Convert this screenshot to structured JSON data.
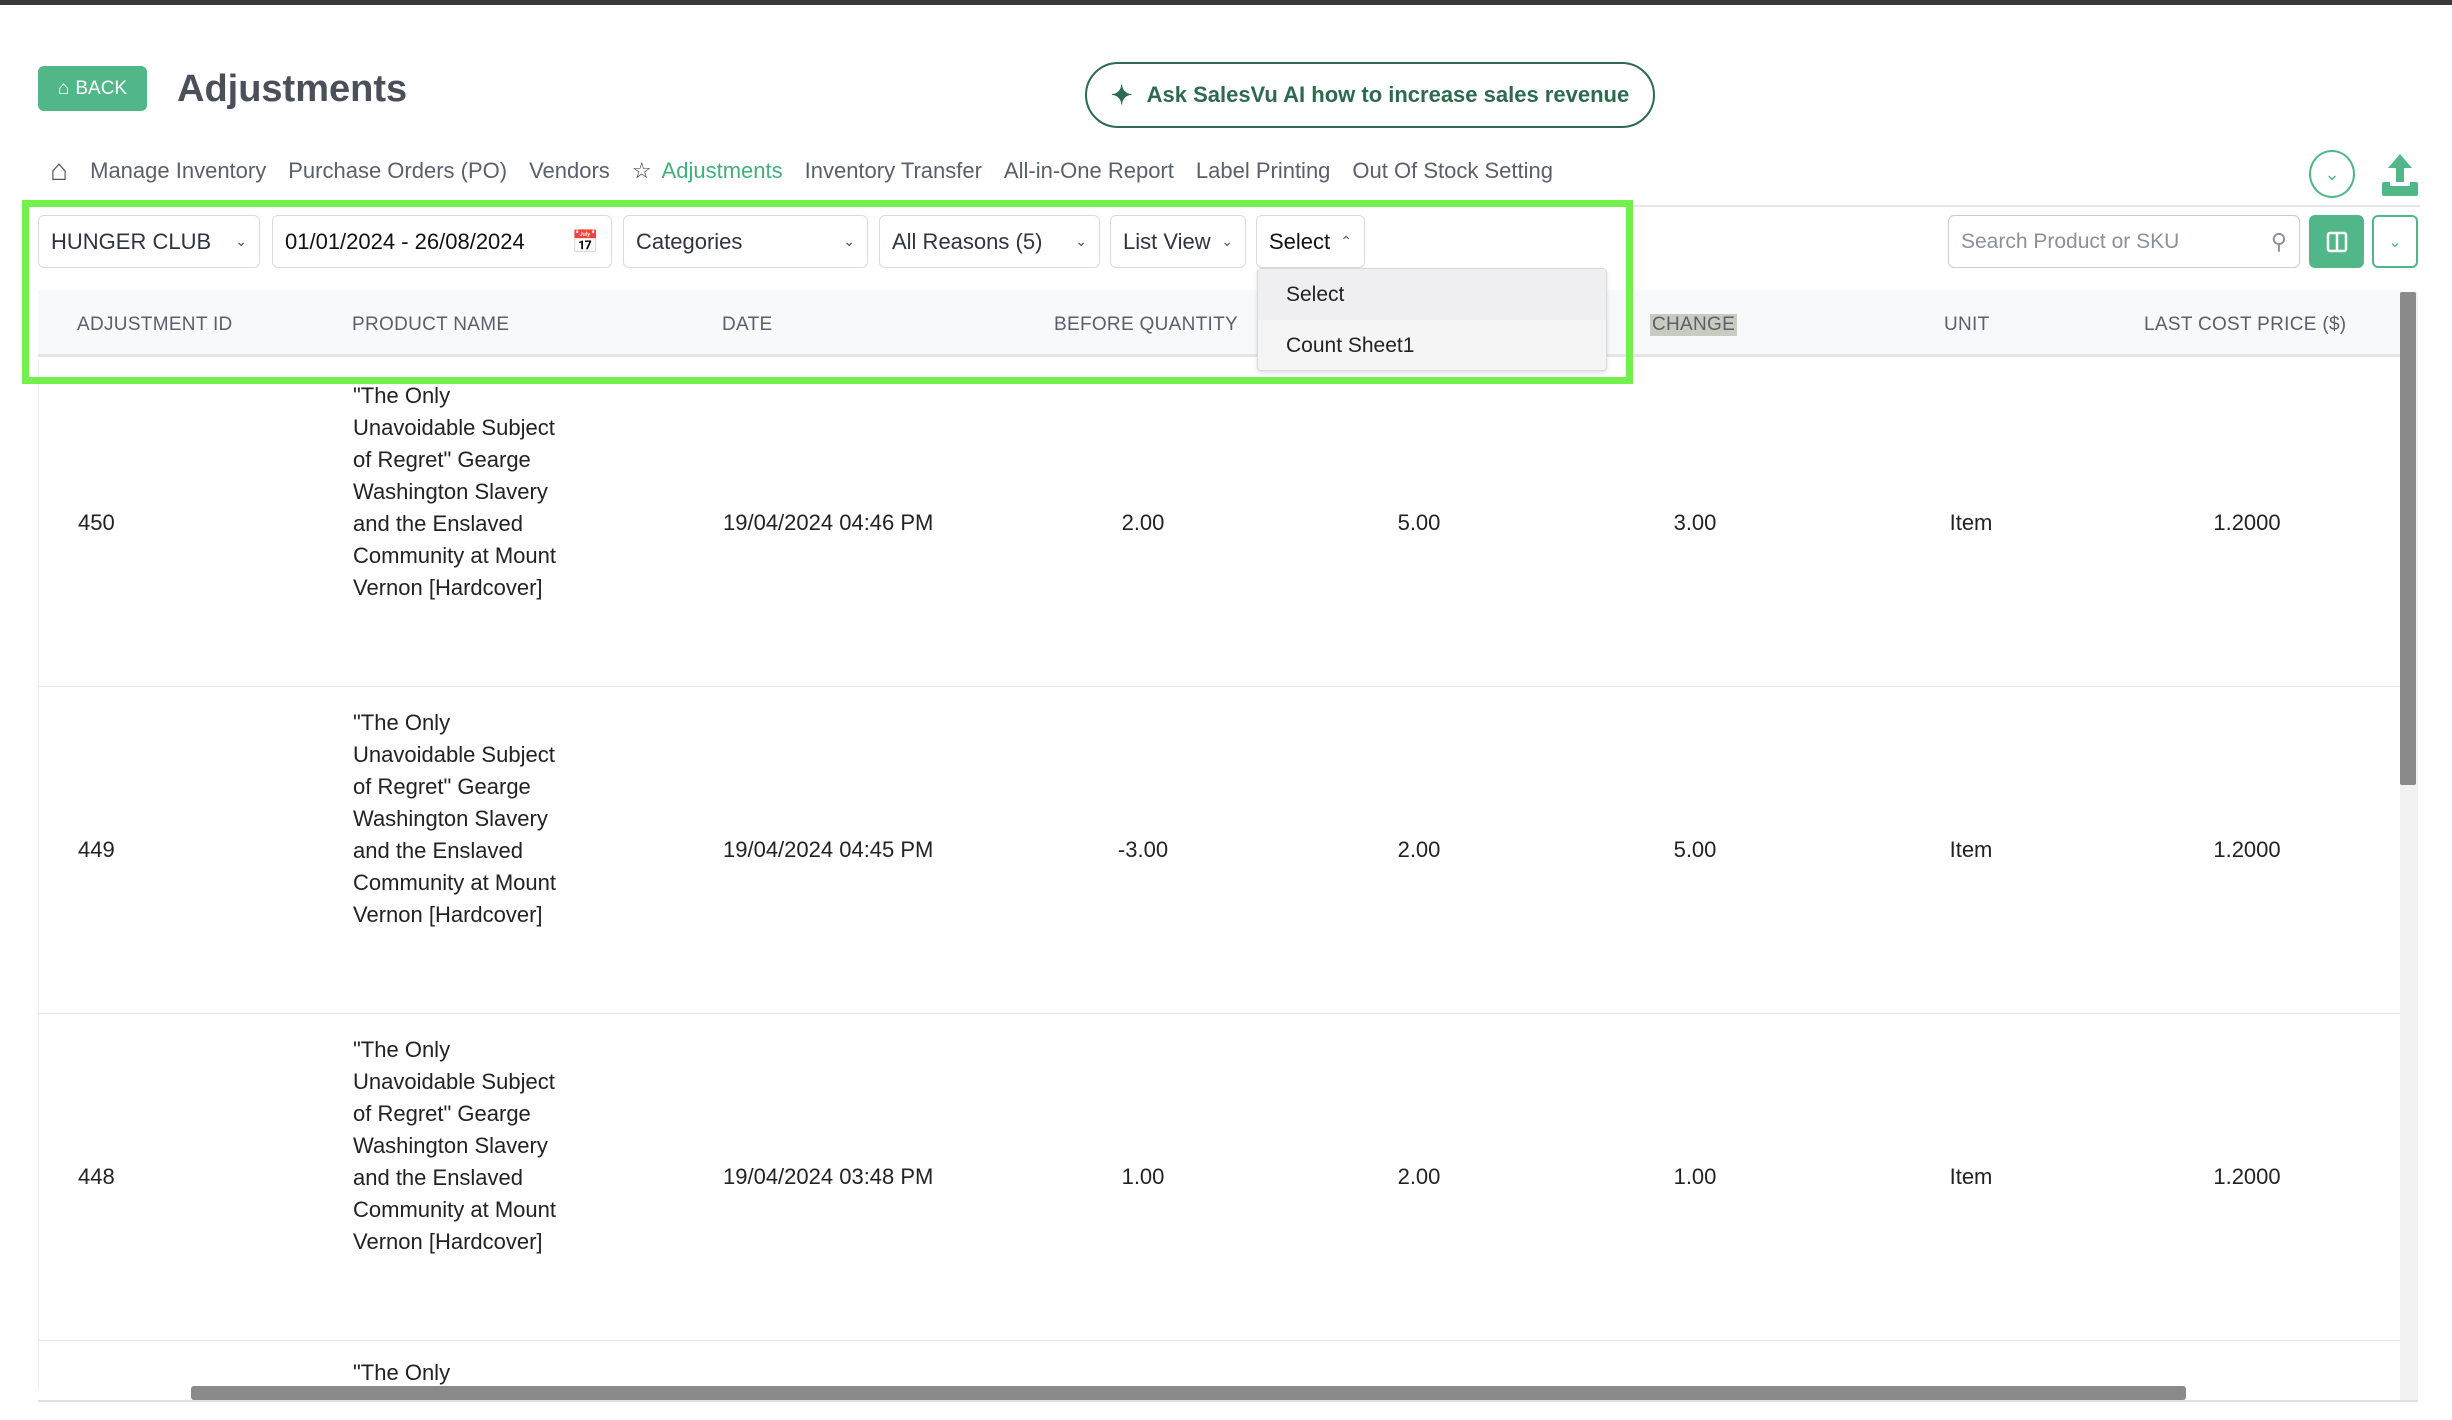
{
  "header": {
    "back_label": "BACK",
    "title": "Adjustments",
    "ai_button": "Ask SalesVu AI how to increase sales revenue"
  },
  "nav": {
    "items": [
      "Manage Inventory",
      "Purchase Orders (PO)",
      "Vendors",
      "Adjustments",
      "Inventory Transfer",
      "All-in-One Report",
      "Label Printing",
      "Out Of Stock Setting"
    ],
    "active": "Adjustments"
  },
  "filters": {
    "location": "HUNGER CLUB",
    "date_range": "01/01/2024 - 26/08/2024",
    "categories": "Categories",
    "reasons": "All Reasons (5)",
    "view": "List View",
    "select": "Select"
  },
  "dropdown": {
    "options": [
      "Select",
      "Count Sheet1"
    ]
  },
  "search": {
    "placeholder": "Search Product or SKU"
  },
  "table": {
    "headers": [
      "ADJUSTMENT ID",
      "PRODUCT NAME",
      "DATE",
      "BEFORE QUANTITY",
      "",
      "CHANGE",
      "UNIT",
      "LAST COST PRICE ($)"
    ],
    "rows": [
      {
        "id": "450",
        "product": "\"The Only Unavoidable Subject of Regret\" Gearge Washington Slavery and the Enslaved Community at Mount Vernon [Hardcover]",
        "date": "19/04/2024 04:46 PM",
        "before": "2.00",
        "after": "5.00",
        "change": "3.00",
        "unit": "Item",
        "cost": "1.2000"
      },
      {
        "id": "449",
        "product": "\"The Only Unavoidable Subject of Regret\" Gearge Washington Slavery and the Enslaved Community at Mount Vernon [Hardcover]",
        "date": "19/04/2024 04:45 PM",
        "before": "-3.00",
        "after": "2.00",
        "change": "5.00",
        "unit": "Item",
        "cost": "1.2000"
      },
      {
        "id": "448",
        "product": "\"The Only Unavoidable Subject of Regret\" Gearge Washington Slavery and the Enslaved Community at Mount Vernon [Hardcover]",
        "date": "19/04/2024 03:48 PM",
        "before": "1.00",
        "after": "2.00",
        "change": "1.00",
        "unit": "Item",
        "cost": "1.2000"
      },
      {
        "id": "",
        "product": "\"The Only",
        "date": "",
        "before": "",
        "after": "",
        "change": "",
        "unit": "",
        "cost": ""
      }
    ]
  },
  "colors": {
    "accent": "#52b788",
    "dark_green": "#2d6a4f",
    "highlight": "#72f04c"
  }
}
